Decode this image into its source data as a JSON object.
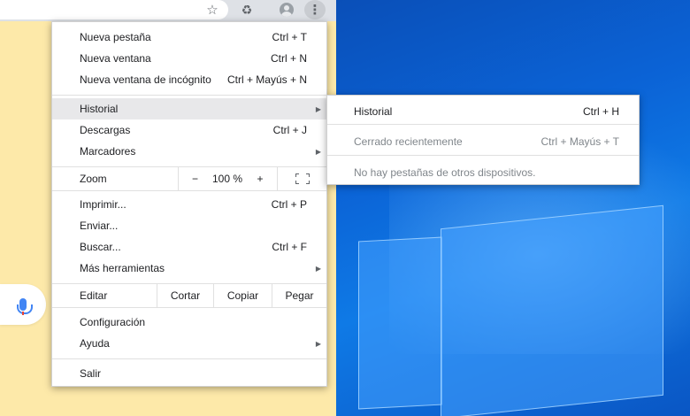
{
  "toolbar": {
    "star_icon": "star-icon",
    "extension_icon": "recycle-icon",
    "profile_icon": "profile-avatar-icon",
    "menu_icon": "vertical-dots-icon"
  },
  "menu": {
    "new_tab": {
      "label": "Nueva pestaña",
      "shortcut": "Ctrl + T"
    },
    "new_window": {
      "label": "Nueva ventana",
      "shortcut": "Ctrl + N"
    },
    "incognito": {
      "label": "Nueva ventana de incógnito",
      "shortcut": "Ctrl + Mayús + N"
    },
    "history": {
      "label": "Historial"
    },
    "downloads": {
      "label": "Descargas",
      "shortcut": "Ctrl + J"
    },
    "bookmarks": {
      "label": "Marcadores"
    },
    "zoom": {
      "label": "Zoom",
      "minus": "−",
      "value": "100 %",
      "plus": "+"
    },
    "print": {
      "label": "Imprimir...",
      "shortcut": "Ctrl + P"
    },
    "cast": {
      "label": "Enviar..."
    },
    "find": {
      "label": "Buscar...",
      "shortcut": "Ctrl + F"
    },
    "more_tools": {
      "label": "Más herramientas"
    },
    "edit": {
      "label": "Editar",
      "cut": "Cortar",
      "copy": "Copiar",
      "paste": "Pegar"
    },
    "settings": {
      "label": "Configuración"
    },
    "help": {
      "label": "Ayuda"
    },
    "exit": {
      "label": "Salir"
    }
  },
  "submenu": {
    "history": {
      "label": "Historial",
      "shortcut": "Ctrl + H"
    },
    "recently_closed": {
      "label": "Cerrado recientemente",
      "shortcut": "Ctrl + Mayús + T"
    },
    "no_tabs": {
      "label": "No hay pestañas de otros dispositivos."
    }
  },
  "colors": {
    "page_background": "#fde9a9",
    "desktop_blue": "#0b63d6",
    "menu_highlight": "#e8e8ea",
    "mic_blue": "#4285f4"
  }
}
